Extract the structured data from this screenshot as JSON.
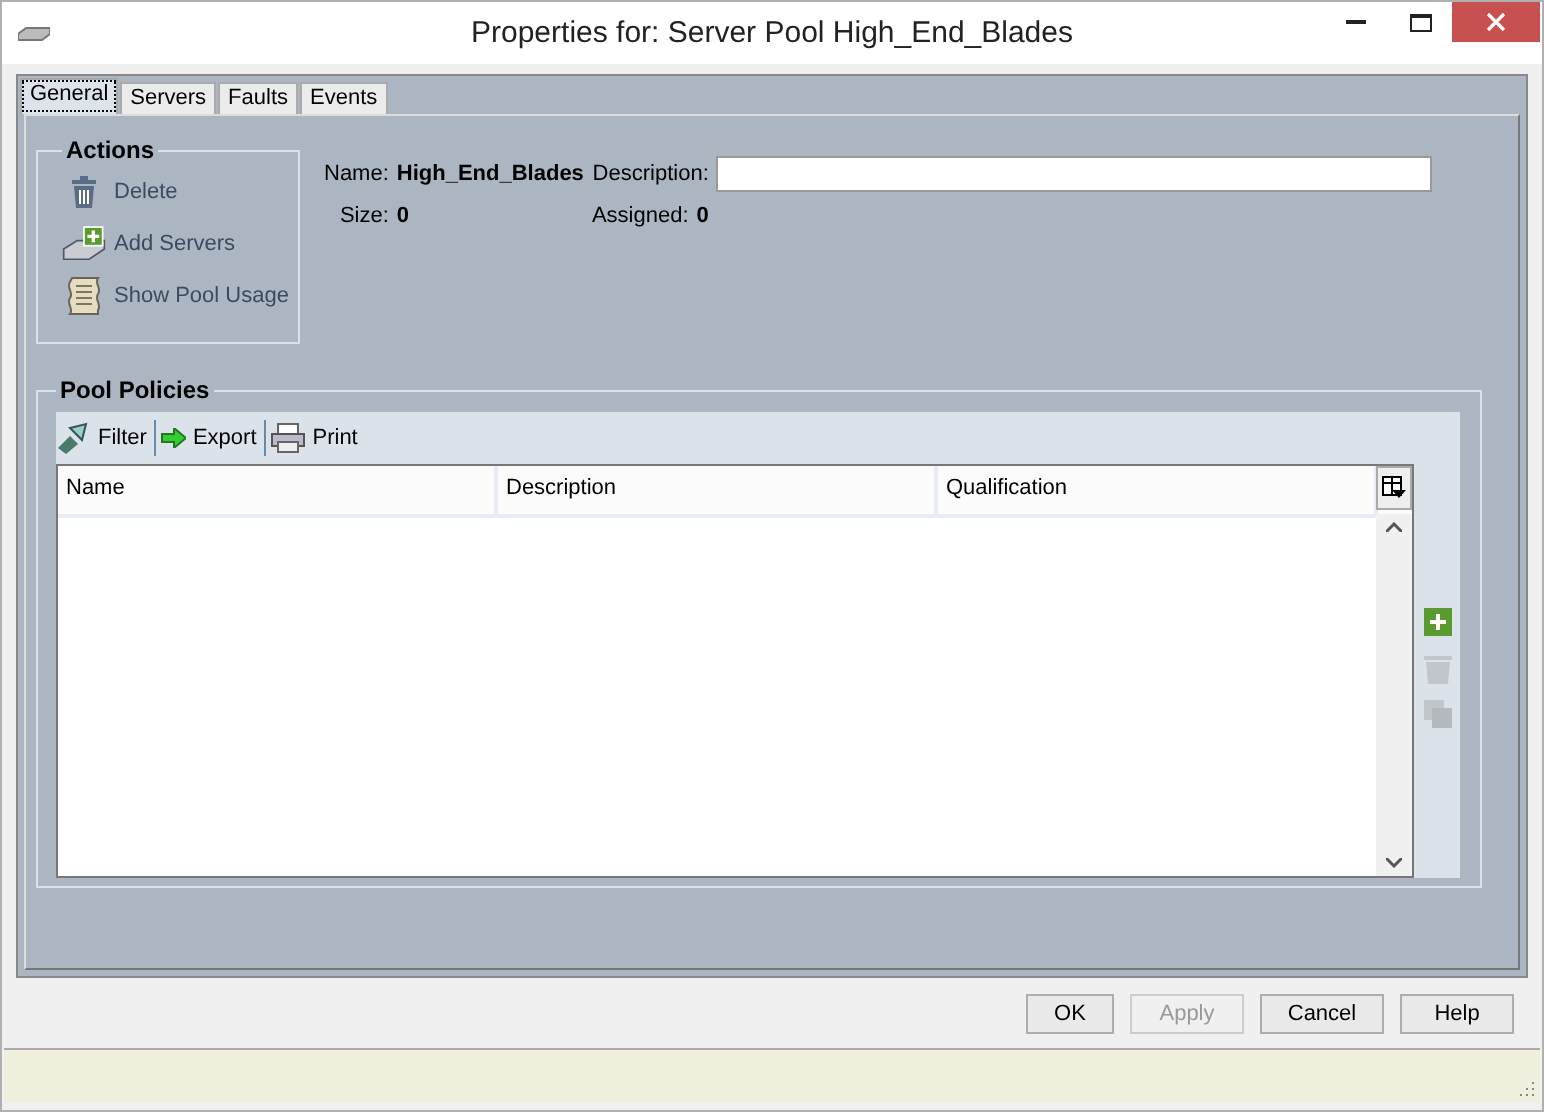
{
  "window": {
    "title": "Properties for: Server Pool High_End_Blades"
  },
  "tabs": [
    {
      "label": "General",
      "selected": true
    },
    {
      "label": "Servers",
      "selected": false
    },
    {
      "label": "Faults",
      "selected": false
    },
    {
      "label": "Events",
      "selected": false
    }
  ],
  "actions": {
    "title": "Actions",
    "items": [
      {
        "kind": "delete",
        "label": "Delete"
      },
      {
        "kind": "add",
        "label": "Add Servers"
      },
      {
        "kind": "usage",
        "label": "Show Pool Usage"
      }
    ]
  },
  "properties": {
    "name_label": "Name:",
    "name": "High_End_Blades",
    "description_label": "Description:",
    "size_label": "Size:",
    "size": "0",
    "assigned_label": "Assigned:",
    "assigned": "0"
  },
  "pool_policies": {
    "title": "Pool Policies",
    "toolbar": [
      {
        "kind": "filter",
        "label": "Filter"
      },
      {
        "kind": "export",
        "label": "Export"
      },
      {
        "kind": "print",
        "label": "Print"
      }
    ],
    "columns": [
      "Name",
      "Description",
      "Qualification"
    ],
    "side_tools": [
      {
        "kind": "add",
        "disabled": false
      },
      {
        "kind": "delete",
        "disabled": true
      },
      {
        "kind": "copy",
        "disabled": true
      }
    ]
  },
  "buttons": [
    {
      "label": "OK",
      "disabled": false
    },
    {
      "label": "Apply",
      "disabled": true
    },
    {
      "label": "Cancel",
      "disabled": false
    },
    {
      "label": "Help",
      "disabled": false
    }
  ]
}
